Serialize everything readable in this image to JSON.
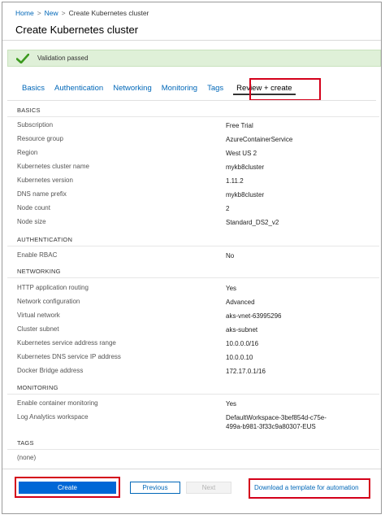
{
  "breadcrumb": {
    "home": "Home",
    "new": "New",
    "current": "Create Kubernetes cluster",
    "separator": ">"
  },
  "page_title": "Create Kubernetes cluster",
  "validation": {
    "message": "Validation passed",
    "color": "#dff0d8"
  },
  "tabs": [
    {
      "label": "Basics"
    },
    {
      "label": "Authentication"
    },
    {
      "label": "Networking"
    },
    {
      "label": "Monitoring"
    },
    {
      "label": "Tags"
    },
    {
      "label": "Review + create",
      "active": true
    }
  ],
  "sections": {
    "basics": {
      "heading": "BASICS",
      "rows": [
        {
          "label": "Subscription",
          "value": "Free Trial"
        },
        {
          "label": "Resource group",
          "value": "AzureContainerService"
        },
        {
          "label": "Region",
          "value": "West US 2"
        },
        {
          "label": "Kubernetes cluster name",
          "value": "mykb8cluster"
        },
        {
          "label": "Kubernetes version",
          "value": "1.11.2"
        },
        {
          "label": "DNS name prefix",
          "value": "mykb8cluster"
        },
        {
          "label": "Node count",
          "value": "2"
        },
        {
          "label": "Node size",
          "value": "Standard_DS2_v2"
        }
      ]
    },
    "authentication": {
      "heading": "AUTHENTICATION",
      "rows": [
        {
          "label": "Enable RBAC",
          "value": "No"
        }
      ]
    },
    "networking": {
      "heading": "NETWORKING",
      "rows": [
        {
          "label": "HTTP application routing",
          "value": "Yes"
        },
        {
          "label": "Network configuration",
          "value": "Advanced"
        },
        {
          "label": "Virtual network",
          "value": "aks-vnet-63995296"
        },
        {
          "label": "Cluster subnet",
          "value": "aks-subnet"
        },
        {
          "label": "Kubernetes service address range",
          "value": "10.0.0.0/16"
        },
        {
          "label": "Kubernetes DNS service IP address",
          "value": "10.0.0.10"
        },
        {
          "label": "Docker Bridge address",
          "value": "172.17.0.1/16"
        }
      ]
    },
    "monitoring": {
      "heading": "MONITORING",
      "rows": [
        {
          "label": "Enable container monitoring",
          "value": "Yes"
        },
        {
          "label": "Log Analytics workspace",
          "value_line1": "DefaultWorkspace-3bef854d-c75e-",
          "value_line2": "499a-b981-3f33c9a80307-EUS"
        }
      ]
    },
    "tags": {
      "heading": "TAGS",
      "rows": [
        {
          "label": "(none)"
        }
      ]
    }
  },
  "footer": {
    "create_label": "Create",
    "previous_label": "Previous",
    "next_label": "Next",
    "download_label": "Download a template for automation"
  },
  "colors": {
    "accent": "#0067b8",
    "primary_button": "#0067d6",
    "highlight": "#d4001a",
    "success": "#3c9a1f"
  }
}
